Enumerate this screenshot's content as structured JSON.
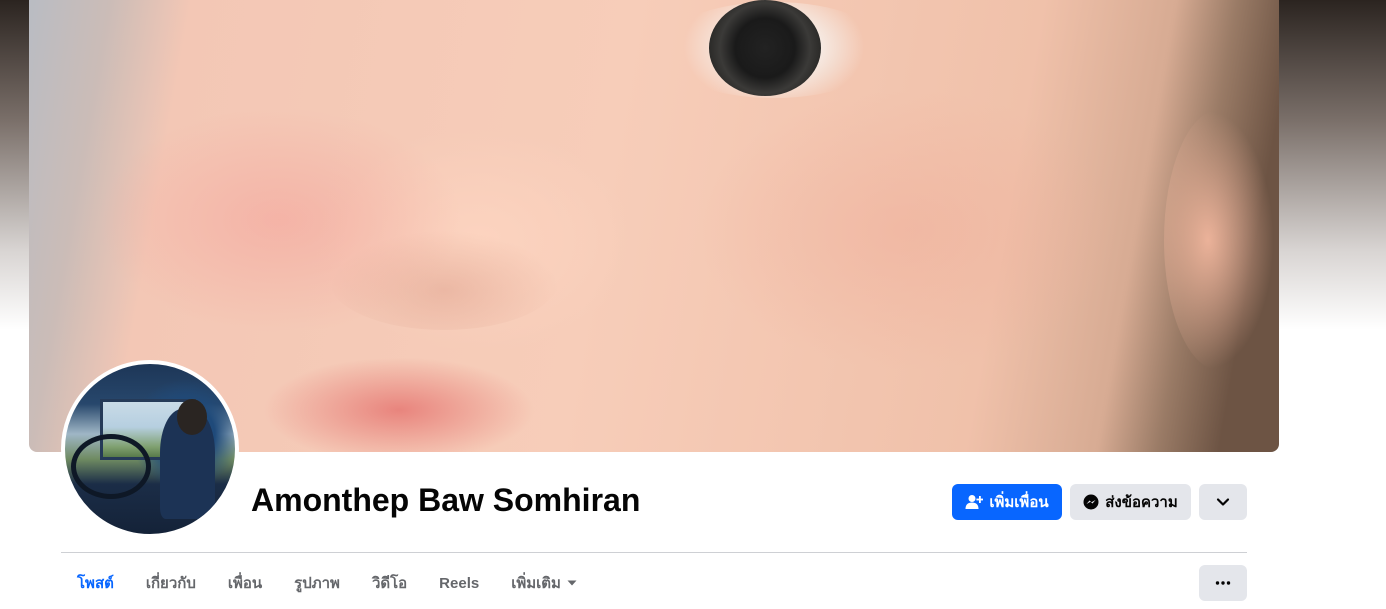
{
  "profile": {
    "name": "Amonthep Baw Somhiran"
  },
  "actions": {
    "add_friend_label": "เพิ่มเพื่อน",
    "message_label": "ส่งข้อความ",
    "add_friend_icon": "person-add-icon",
    "message_icon": "messenger-icon",
    "more_icon": "chevron-down-icon"
  },
  "tabs": [
    {
      "label": "โพสต์",
      "active": true
    },
    {
      "label": "เกี่ยวกับ",
      "active": false
    },
    {
      "label": "เพื่อน",
      "active": false
    },
    {
      "label": "รูปภาพ",
      "active": false
    },
    {
      "label": "วิดีโอ",
      "active": false
    },
    {
      "label": "Reels",
      "active": false
    },
    {
      "label": "เพิ่มเติม",
      "active": false
    }
  ],
  "tab_overflow_icon": "ellipsis-icon",
  "colors": {
    "accent": "#0866ff",
    "secondary_button": "#e4e6eb",
    "text_primary": "#050505",
    "text_secondary": "#65676b"
  }
}
